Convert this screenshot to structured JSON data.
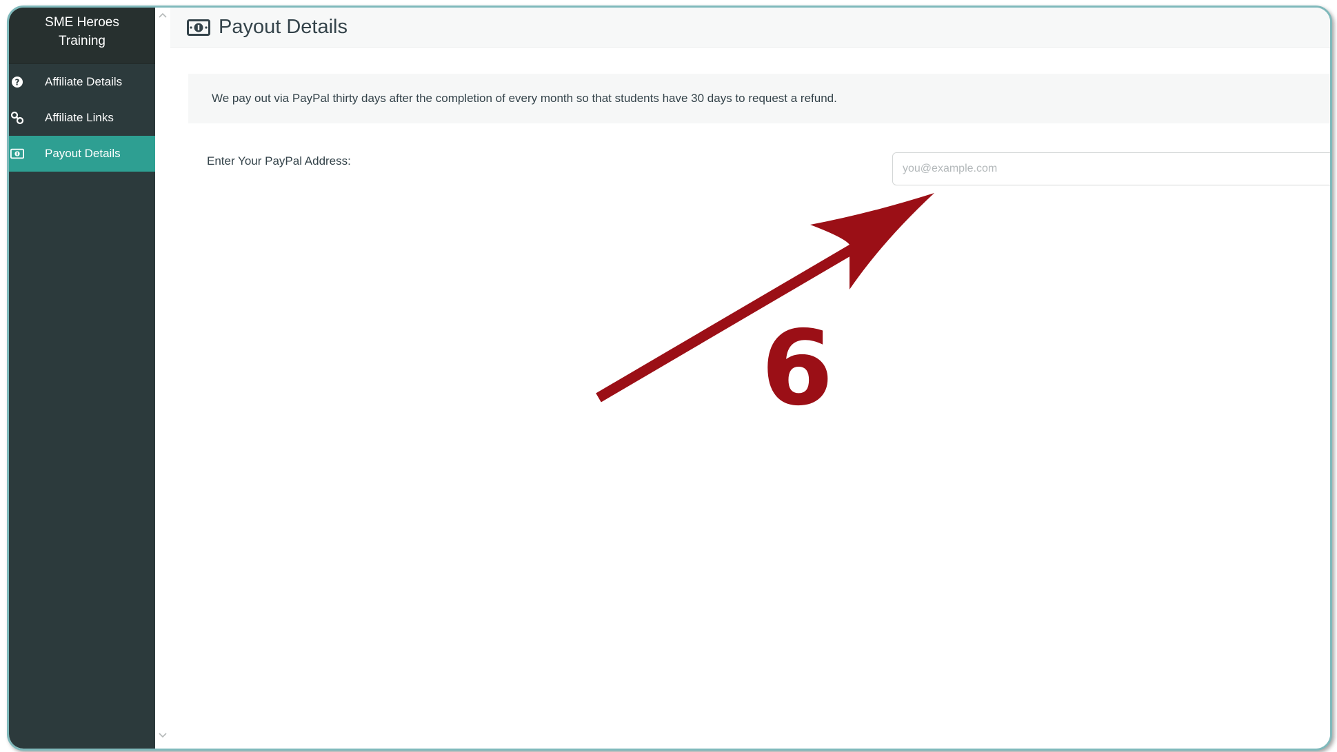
{
  "sidebar": {
    "brand_line1": "SME Heroes",
    "brand_line2": "Training",
    "items": [
      {
        "label": "Affiliate Details",
        "icon": "question-circle-icon",
        "active": false
      },
      {
        "label": "Affiliate Links",
        "icon": "link-icon",
        "active": false
      },
      {
        "label": "Payout Details",
        "icon": "money-icon",
        "active": true
      }
    ]
  },
  "header": {
    "title": "Payout Details",
    "icon": "money-icon"
  },
  "info": {
    "text": "We pay out via PayPal thirty days after the completion of every month so that students have 30 days to request a refund."
  },
  "form": {
    "paypal_label": "Enter Your PayPal Address:",
    "paypal_placeholder": "you@example.com",
    "paypal_value": ""
  },
  "annotation": {
    "step": "6",
    "color": "#9b0f16"
  },
  "colors": {
    "sidebar_bg": "#2c3a3c",
    "active_item": "#2e9f92",
    "frame_border": "#7fb9bb"
  }
}
